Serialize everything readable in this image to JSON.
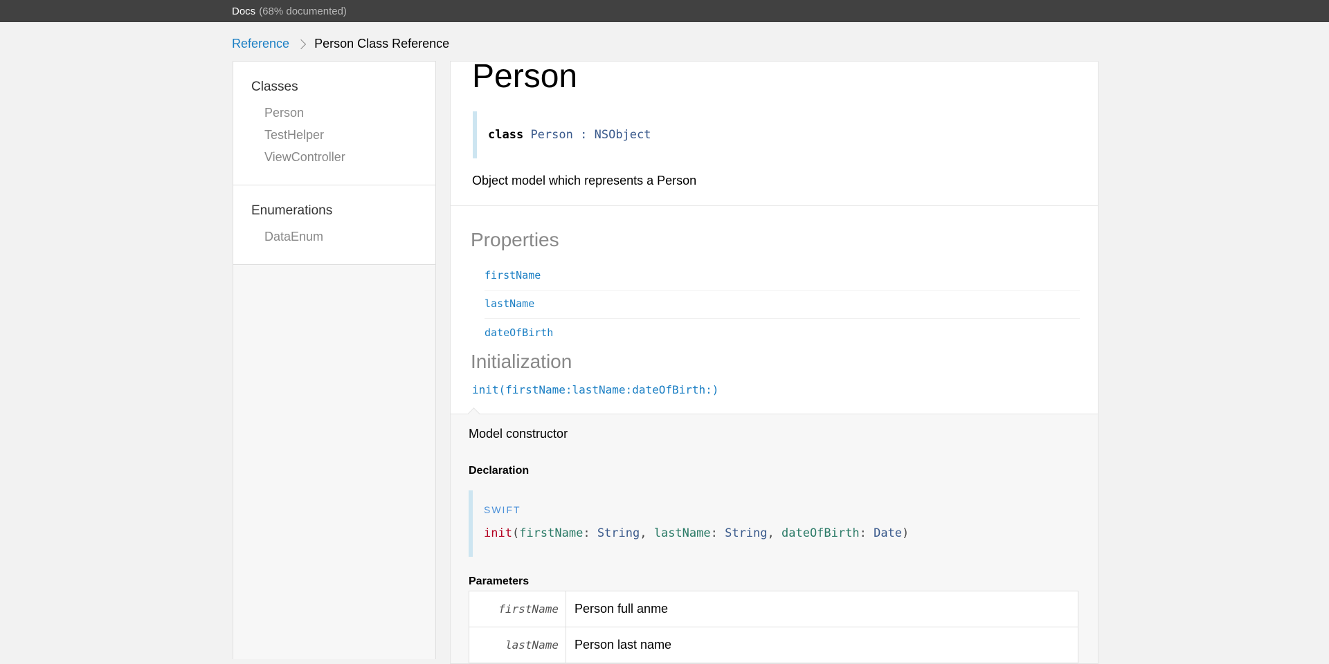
{
  "topbar": {
    "title": "Docs",
    "coverage": "(68% documented)"
  },
  "breadcrumb": {
    "root": "Reference",
    "current": "Person Class Reference"
  },
  "sidebar": {
    "sections": [
      {
        "title": "Classes",
        "items": [
          "Person",
          "TestHelper",
          "ViewController"
        ]
      },
      {
        "title": "Enumerations",
        "items": [
          "DataEnum"
        ]
      }
    ]
  },
  "main": {
    "title": "Person",
    "declaration": {
      "keyword": "class",
      "name": "Person",
      "colon": ":",
      "superclass": "NSObject"
    },
    "description": "Object model which represents a Person",
    "properties_title": "Properties",
    "properties": [
      "firstName",
      "lastName",
      "dateOfBirth"
    ],
    "initialization_title": "Initialization",
    "init_link": "init(firstName:lastName:dateOfBirth:)",
    "detail": {
      "summary": "Model constructor",
      "declaration_heading": "Declaration",
      "language": "SWIFT",
      "signature": {
        "fn": "init",
        "p1": "firstName",
        "t1": "String",
        "p2": "lastName",
        "t2": "String",
        "p3": "dateOfBirth",
        "t3": "Date"
      },
      "parameters_heading": "Parameters",
      "parameters": [
        {
          "name": "firstName",
          "desc": "Person full anme"
        },
        {
          "name": "lastName",
          "desc": "Person last name"
        }
      ]
    }
  }
}
